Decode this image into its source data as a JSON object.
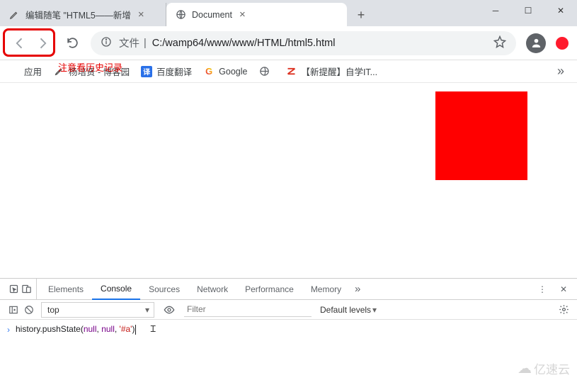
{
  "tabs": [
    {
      "title": "编辑随笔 \"HTML5——新增",
      "favicon": "pen",
      "active": false
    },
    {
      "title": "Document",
      "favicon": "globe",
      "active": true
    }
  ],
  "annotation": "注意看历史记录",
  "address": {
    "info_label": "文件",
    "separator": "|",
    "url": "C:/wamp64/www/www/HTML/html5.html"
  },
  "bookmarks": [
    {
      "icon": "apps",
      "label": "应用"
    },
    {
      "icon": "pen",
      "label": "杨培贤 - 博客园"
    },
    {
      "icon": "yi",
      "label": "百度翻译"
    },
    {
      "icon": "google",
      "label": "Google"
    },
    {
      "icon": "globe-gray",
      "label": ""
    },
    {
      "icon": "sz",
      "label": "【新提醒】自学IT..."
    }
  ],
  "page": {
    "red_square": true
  },
  "devtools": {
    "tabs": [
      "Elements",
      "Console",
      "Sources",
      "Network",
      "Performance",
      "Memory"
    ],
    "active_tab": "Console",
    "context": "top",
    "filter_placeholder": "Filter",
    "levels": "Default levels",
    "console": {
      "method": "history.pushState",
      "arg1": "null",
      "arg2": "null",
      "arg3": "'#a'"
    }
  },
  "watermark": "亿速云"
}
